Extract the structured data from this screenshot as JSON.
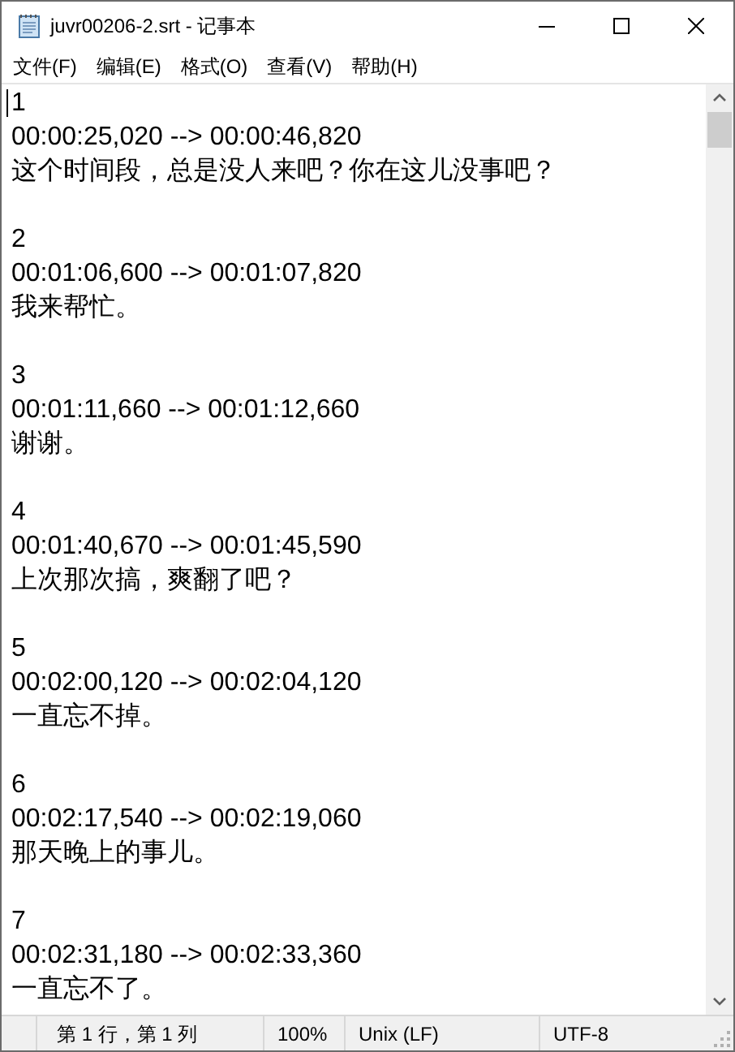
{
  "window": {
    "title": "juvr00206-2.srt - 记事本"
  },
  "menu": [
    "文件(F)",
    "编辑(E)",
    "格式(O)",
    "查看(V)",
    "帮助(H)"
  ],
  "entries": [
    {
      "index": "1",
      "time": "00:00:25,020 --> 00:00:46,820",
      "text": "这个时间段，总是没人来吧？你在这儿没事吧？"
    },
    {
      "index": "2",
      "time": "00:01:06,600 --> 00:01:07,820",
      "text": "我来帮忙。"
    },
    {
      "index": "3",
      "time": "00:01:11,660 --> 00:01:12,660",
      "text": "谢谢。"
    },
    {
      "index": "4",
      "time": "00:01:40,670 --> 00:01:45,590",
      "text": "上次那次搞，爽翻了吧？"
    },
    {
      "index": "5",
      "time": "00:02:00,120 --> 00:02:04,120",
      "text": "一直忘不掉。"
    },
    {
      "index": "6",
      "time": "00:02:17,540 --> 00:02:19,060",
      "text": "那天晚上的事儿。"
    },
    {
      "index": "7",
      "time": "00:02:31,180 --> 00:02:33,360",
      "text": "一直忘不了。"
    }
  ],
  "status_bar": {
    "position": "第 1 行，第 1 列",
    "zoom": "100%",
    "line_ending": "Unix (LF)",
    "encoding": "UTF-8"
  }
}
